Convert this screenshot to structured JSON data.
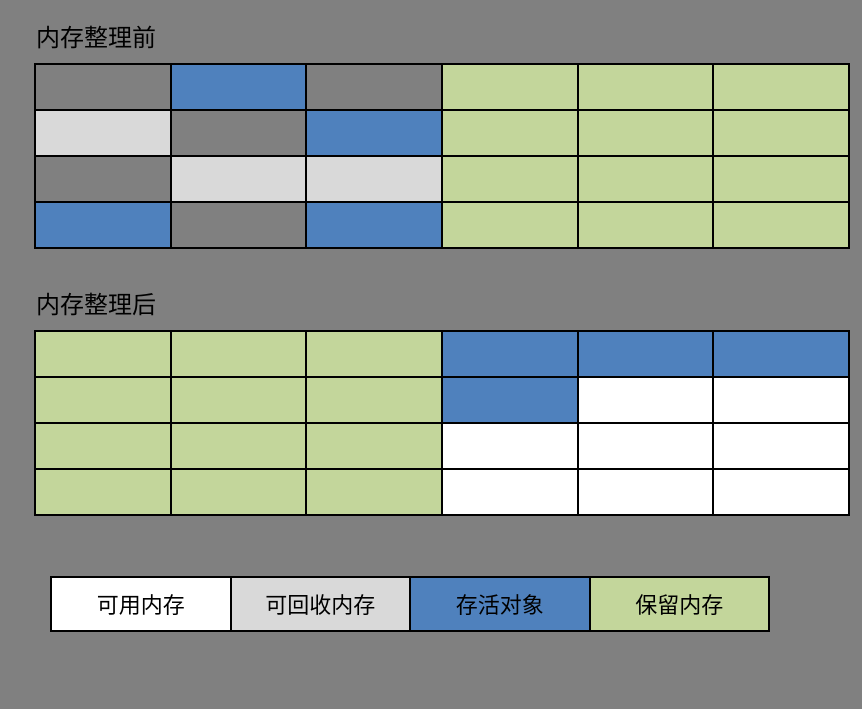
{
  "titles": {
    "before": "内存整理前",
    "after": "内存整理后"
  },
  "gridBefore": [
    [
      "gray",
      "blue",
      "gray",
      "green",
      "green",
      "green"
    ],
    [
      "lightgray",
      "gray",
      "blue",
      "green",
      "green",
      "green"
    ],
    [
      "gray",
      "lightgray",
      "lightgray",
      "green",
      "green",
      "green"
    ],
    [
      "blue",
      "gray",
      "blue",
      "green",
      "green",
      "green"
    ]
  ],
  "gridAfter": [
    [
      "green",
      "green",
      "green",
      "blue",
      "blue",
      "blue"
    ],
    [
      "green",
      "green",
      "green",
      "blue",
      "white",
      "white"
    ],
    [
      "green",
      "green",
      "green",
      "white",
      "white",
      "white"
    ],
    [
      "green",
      "green",
      "green",
      "white",
      "white",
      "white"
    ]
  ],
  "legend": [
    {
      "label": "可用内存",
      "class": "legend-white"
    },
    {
      "label": "可回收内存",
      "class": "legend-lightgray"
    },
    {
      "label": "存活对象",
      "class": "legend-blue"
    },
    {
      "label": "保留内存",
      "class": "legend-green"
    }
  ]
}
